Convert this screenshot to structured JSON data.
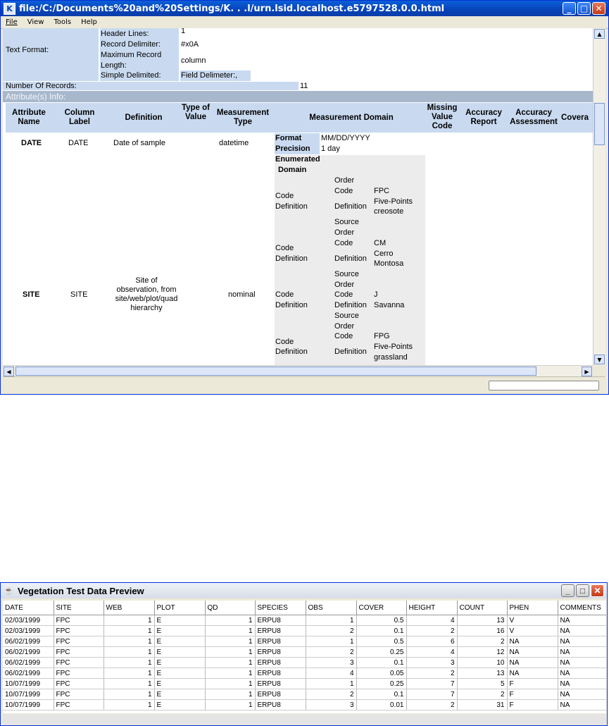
{
  "kepler_window": {
    "title": "file:/C:/Documents%20and%20Settings/K. . .l/urn.lsid.localhost.e5797528.0.0.html",
    "menu": [
      "File",
      "View",
      "Tools",
      "Help"
    ],
    "text_format": {
      "label": "Text Format:",
      "header_lines_label": "Header Lines:",
      "header_lines_value": "1",
      "record_delimiter_label": "Record Delimiter:",
      "record_delimiter_value": "#x0A",
      "max_record_length_label_1": "Maximum Record",
      "max_record_length_label_2": "Length:",
      "max_record_length_value": "column",
      "simple_delimited_label": "Simple Delimited:",
      "field_delimiter_label": "Field Delimeter:",
      "field_delimiter_value": ","
    },
    "number_of_records_label": "Number Of Records:",
    "number_of_records_value": "11",
    "attribute_info_label": "Attribute(s) Info:",
    "columns": [
      "Attribute Name",
      "Column Label",
      "Definition",
      "Type of Value",
      "Measurement Type",
      "Measurement Domain",
      "Missing Value Code",
      "Accuracy Report",
      "Accuracy Assessment",
      "Covera"
    ],
    "attributes": [
      {
        "name": "DATE",
        "label": "DATE",
        "definition": "Date of sample",
        "measurement_type": "datetime",
        "format_label": "Format",
        "format_value": "MM/DD/YYYY",
        "precision_label": "Precision",
        "precision_value": "1 day"
      },
      {
        "name": "SITE",
        "label": "SITE",
        "definition_lines": [
          "Site of",
          "observation, from",
          "site/web/plot/quad",
          "hierarchy"
        ],
        "measurement_type": "nominal",
        "enumerated_domain_label_1": "Enumerated",
        "enumerated_domain_label_2": "Domain",
        "code_word": "Code",
        "definition_word": "Definition",
        "order_word": "Order",
        "source_word": "Source",
        "codes": [
          {
            "code": "FPC",
            "definition_lines": [
              "Five-Points",
              "creosote"
            ]
          },
          {
            "code": "CM",
            "definition_lines": [
              "Cerro",
              "Montosa"
            ]
          },
          {
            "code": "J",
            "definition_lines": [
              "Savanna"
            ]
          },
          {
            "code": "FPG",
            "definition_lines": [
              "Five-Points",
              "grassland"
            ]
          }
        ]
      }
    ]
  },
  "preview_window": {
    "title": "Vegetation Test Data Preview",
    "headers": [
      "DATE",
      "SITE",
      "WEB",
      "PLOT",
      "QD",
      "SPECIES",
      "OBS",
      "COVER",
      "HEIGHT",
      "COUNT",
      "PHEN",
      "COMMENTS"
    ],
    "rows": [
      [
        "02/03/1999",
        "FPC",
        "1",
        "E",
        "1",
        "ERPU8",
        "1",
        "0.5",
        "4",
        "13",
        "V",
        "NA"
      ],
      [
        "02/03/1999",
        "FPC",
        "1",
        "E",
        "1",
        "ERPU8",
        "2",
        "0.1",
        "2",
        "16",
        "V",
        "NA"
      ],
      [
        "06/02/1999",
        "FPC",
        "1",
        "E",
        "1",
        "ERPU8",
        "1",
        "0.5",
        "6",
        "2",
        "NA",
        "NA"
      ],
      [
        "06/02/1999",
        "FPC",
        "1",
        "E",
        "1",
        "ERPU8",
        "2",
        "0.25",
        "4",
        "12",
        "NA",
        "NA"
      ],
      [
        "06/02/1999",
        "FPC",
        "1",
        "E",
        "1",
        "ERPU8",
        "3",
        "0.1",
        "3",
        "10",
        "NA",
        "NA"
      ],
      [
        "06/02/1999",
        "FPC",
        "1",
        "E",
        "1",
        "ERPU8",
        "4",
        "0.05",
        "2",
        "13",
        "NA",
        "NA"
      ],
      [
        "10/07/1999",
        "FPC",
        "1",
        "E",
        "1",
        "ERPU8",
        "1",
        "0.25",
        "7",
        "5",
        "F",
        "NA"
      ],
      [
        "10/07/1999",
        "FPC",
        "1",
        "E",
        "1",
        "ERPU8",
        "2",
        "0.1",
        "7",
        "2",
        "F",
        "NA"
      ],
      [
        "10/07/1999",
        "FPC",
        "1",
        "E",
        "1",
        "ERPU8",
        "3",
        "0.01",
        "2",
        "31",
        "F",
        "NA"
      ]
    ]
  },
  "colors": {
    "titlebar": "#0a5fd8",
    "section_blue": "#c9daf0",
    "attr_header_bar": "#a8b8cc",
    "domain_grey": "#ececec"
  }
}
